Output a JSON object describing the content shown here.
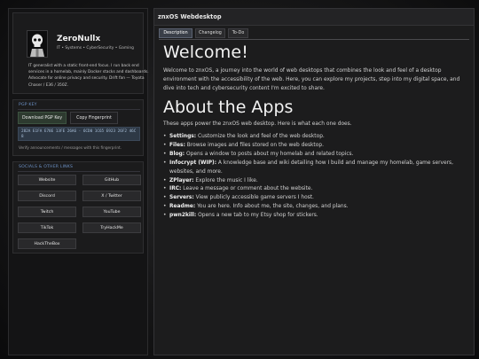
{
  "profile": {
    "name": "ZeroNullx",
    "tagline": "IT • Systems • CyberSecurity • Gaming",
    "bio": "IT generalist with a static front-end focus. I run back end services in a homelab, mainly Docker stacks and dashboards. Advocate for online privacy and security. Drift fan — Toyota Chaser / E36 / 350Z."
  },
  "pgp": {
    "title": "PGP KEY",
    "download_label": "Download PGP Key",
    "copy_label": "Copy Fingerprint",
    "fingerprint": "282A E1FA E78E 13FE 26A6 · 6CD0 1C65 E923 26F2 46C8",
    "note": "Verify announcements / messages with this fingerprint."
  },
  "socials": {
    "title": "SOCIALS & OTHER LINKS",
    "links": [
      "Website",
      "GitHub",
      "Discord",
      "X / Twitter",
      "Twitch",
      "YouTube",
      "TikTok",
      "TryHackMe",
      "HackTheBox"
    ]
  },
  "window": {
    "title": "znxOS Webdesktop",
    "tabs": [
      "Description",
      "Changelog",
      "To-Do"
    ],
    "active_tab": "Description"
  },
  "content": {
    "welcome_heading": "Welcome!",
    "welcome_text": "Welcome to znxOS, a journey into the world of web desktops that combines the look and feel of a desktop environment with the accessibility of the web. Here, you can explore my projects, step into my digital space, and dive into tech and cybersecurity content I'm excited to share.",
    "apps_heading": "About the Apps",
    "apps_intro": "These apps power the znxOS web desktop. Here is what each one does.",
    "apps": [
      {
        "name": "Settings:",
        "desc": " Customize the look and feel of the web desktop."
      },
      {
        "name": "Files:",
        "desc": " Browse images and files stored on the web desktop."
      },
      {
        "name": "Blog:",
        "desc": " Opens a window to posts about my homelab and related topics."
      },
      {
        "name": "Infocrypt (WIP):",
        "desc": " A knowledge base and wiki detailing how I build and manage my homelab, game servers, websites, and more."
      },
      {
        "name": "ZPlayer:",
        "desc": " Explore the music I like."
      },
      {
        "name": "IRC:",
        "desc": " Leave a message or comment about the website."
      },
      {
        "name": "Servers:",
        "desc": " View publicly accessible game servers I host."
      },
      {
        "name": "Readme:",
        "desc": " You are here. Info about me, the site, changes, and plans."
      },
      {
        "name": "pwn2kill:",
        "desc": " Opens a new tab to my Etsy shop for stickers."
      }
    ]
  },
  "colors": {
    "accent": "#6d92c7",
    "fingerprint_bg": "#2e3946",
    "download_bg": "#2d3a2f"
  },
  "icons": {
    "avatar": "skull-avatar-icon"
  }
}
